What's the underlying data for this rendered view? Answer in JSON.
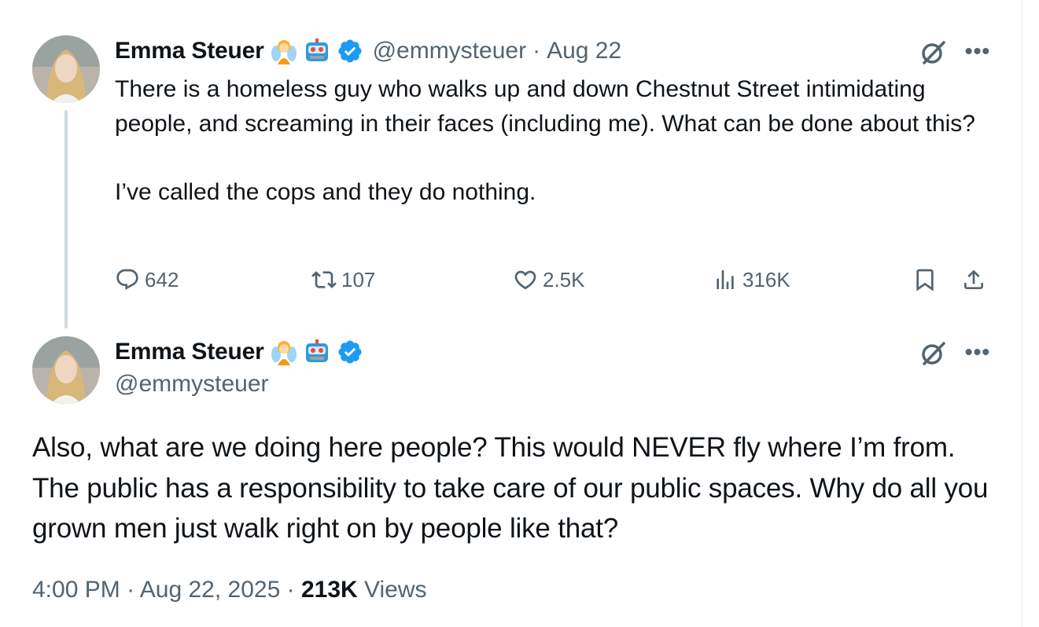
{
  "tweets": [
    {
      "name": "Emma Steuer",
      "handle": "@emmysteuer",
      "separator": "·",
      "date": "Aug 22",
      "text": "There is a homeless guy who walks up and down Chestnut Street intimidating people, and screaming in their faces (including me). What can be done about this?\n\nI’ve called the cops and they do nothing.",
      "icons": [
        "fairy-emoji",
        "robot-emoji",
        "verified-badge-icon"
      ],
      "actions": {
        "replies": "642",
        "reposts": "107",
        "likes": "2.5K",
        "views": "316K"
      }
    },
    {
      "name": "Emma Steuer",
      "handle": "@emmysteuer",
      "text": "Also, what are we doing here people? This would NEVER fly where I’m from. The public has a responsibility to take care of our public spaces. Why do all you grown men just walk right on by people like that?",
      "icons": [
        "fairy-emoji",
        "robot-emoji",
        "verified-badge-icon"
      ],
      "time": "4:00 PM",
      "date": "Aug 22, 2025",
      "views_count": "213K",
      "views_label": "Views",
      "separator": "·"
    }
  ],
  "colors": {
    "text": "#0f1419",
    "secondary": "#536471",
    "verified": "#1d9bf0",
    "thread_line": "#cfd9de"
  }
}
